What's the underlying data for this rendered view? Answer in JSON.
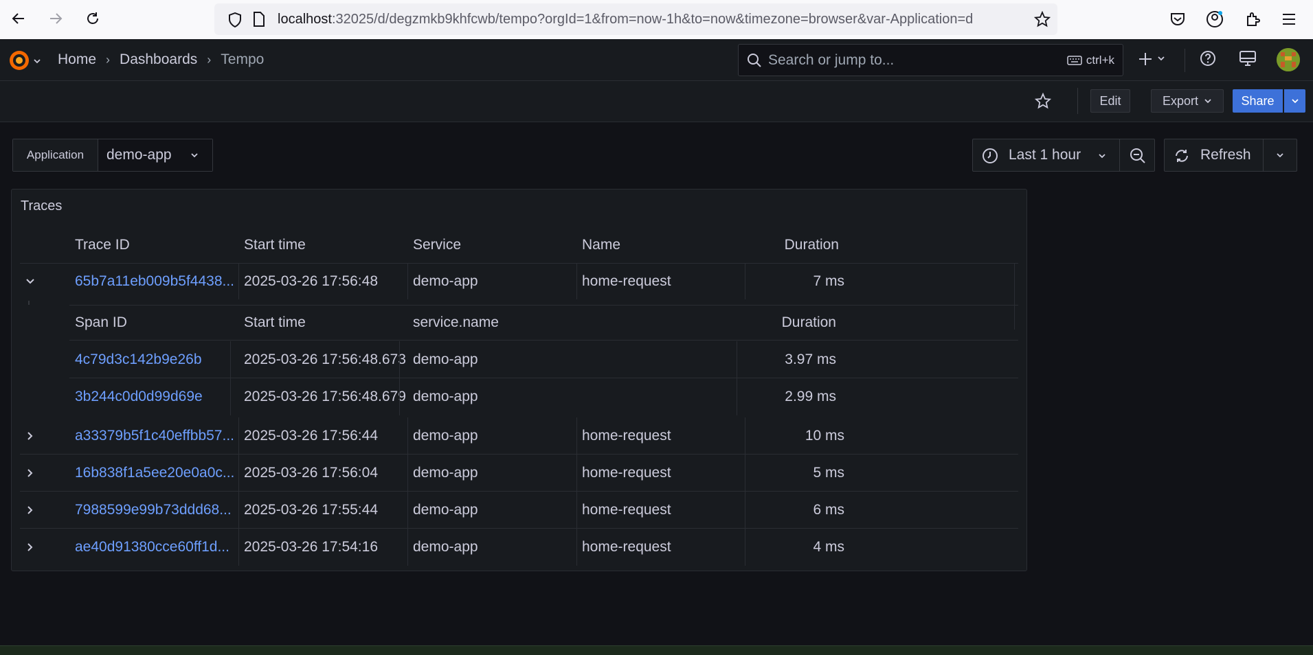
{
  "browser": {
    "url_host": "localhost",
    "url_rest": ":32025/d/degzmkb9khfcwb/tempo?orgId=1&from=now-1h&to=now&timezone=browser&var-Application=d"
  },
  "nav": {
    "breadcrumbs": [
      "Home",
      "Dashboards",
      "Tempo"
    ],
    "search_placeholder": "Search or jump to...",
    "search_shortcut": "ctrl+k"
  },
  "toolbar": {
    "edit_label": "Edit",
    "export_label": "Export",
    "share_label": "Share"
  },
  "variables": {
    "label": "Application",
    "value": "demo-app"
  },
  "time": {
    "range_label": "Last 1 hour",
    "refresh_label": "Refresh"
  },
  "panel": {
    "title": "Traces",
    "columns": [
      "Trace ID",
      "Start time",
      "Service",
      "Name",
      "Duration"
    ],
    "expanded_row": {
      "trace_id": "65b7a11eb009b5f4438...",
      "start": "2025-03-26 17:56:48",
      "service": "demo-app",
      "name": "home-request",
      "duration": "7 ms"
    },
    "span_columns": [
      "Span ID",
      "Start time",
      "service.name",
      "Duration"
    ],
    "spans": [
      {
        "id": "4c79d3c142b9e26b",
        "start": "2025-03-26 17:56:48.673",
        "service": "demo-app",
        "duration": "3.97 ms"
      },
      {
        "id": "3b244c0d0d99d69e",
        "start": "2025-03-26 17:56:48.679",
        "service": "demo-app",
        "duration": "2.99 ms"
      }
    ],
    "rows": [
      {
        "trace_id": "a33379b5f1c40effbb57...",
        "start": "2025-03-26 17:56:44",
        "service": "demo-app",
        "name": "home-request",
        "duration": "10 ms"
      },
      {
        "trace_id": "16b838f1a5ee20e0a0c...",
        "start": "2025-03-26 17:56:04",
        "service": "demo-app",
        "name": "home-request",
        "duration": "5 ms"
      },
      {
        "trace_id": "7988599e99b73ddd68...",
        "start": "2025-03-26 17:55:44",
        "service": "demo-app",
        "name": "home-request",
        "duration": "6 ms"
      },
      {
        "trace_id": "ae40d91380cce60ff1d...",
        "start": "2025-03-26 17:54:16",
        "service": "demo-app",
        "name": "home-request",
        "duration": "4 ms"
      }
    ]
  },
  "colors": {
    "accent": "#3d71d9",
    "link": "#6e9fff",
    "background": "#111217",
    "panel": "#181b1f"
  }
}
